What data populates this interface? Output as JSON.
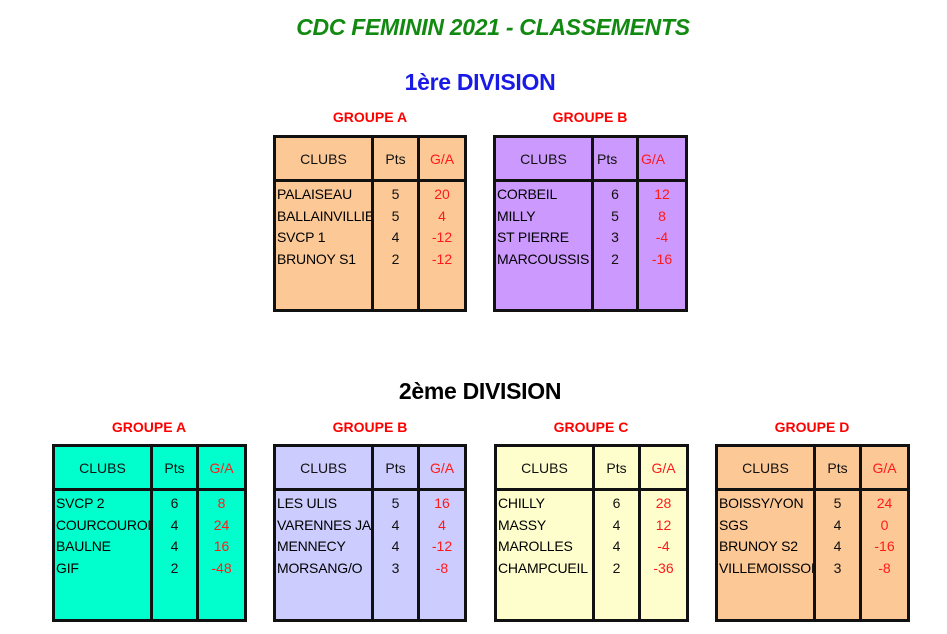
{
  "title": "CDC FEMININ 2021 - CLASSEMENTS",
  "headers": {
    "clubs": "CLUBS",
    "pts": "Pts",
    "ga": "G/A"
  },
  "colors": {
    "title": "#128a12",
    "division1": "#1a1ae6",
    "group_label": "#ff0000",
    "ga_value": "#ff1a1a"
  },
  "divisions": [
    {
      "name": "1ère DIVISION",
      "groups": [
        {
          "label": "GROUPE A",
          "color": "#fcc996",
          "rows": [
            {
              "club": "PALAISEAU",
              "pts": "5",
              "ga": "20"
            },
            {
              "club": "BALLAINVILLIE",
              "pts": "5",
              "ga": "4"
            },
            {
              "club": "SVCP 1",
              "pts": "4",
              "ga": "-12"
            },
            {
              "club": "BRUNOY S1",
              "pts": "2",
              "ga": "-12"
            }
          ]
        },
        {
          "label": "GROUPE B",
          "color": "#cc99fe",
          "rows": [
            {
              "club": "CORBEIL",
              "pts": "6",
              "ga": "12"
            },
            {
              "club": "MILLY",
              "pts": "5",
              "ga": "8"
            },
            {
              "club": "ST PIERRE",
              "pts": "3",
              "ga": "-4"
            },
            {
              "club": "MARCOUSSIS",
              "pts": "2",
              "ga": "-16"
            }
          ]
        }
      ]
    },
    {
      "name": "2ème DIVISION",
      "groups": [
        {
          "label": "GROUPE A",
          "color": "#00ffcc",
          "rows": [
            {
              "club": "SVCP 2",
              "pts": "6",
              "ga": "8"
            },
            {
              "club": "COURCOURONNES",
              "pts": "4",
              "ga": "24"
            },
            {
              "club": "BAULNE",
              "pts": "4",
              "ga": "16"
            },
            {
              "club": "GIF",
              "pts": "2",
              "ga": "-48"
            }
          ]
        },
        {
          "label": "GROUPE B",
          "color": "#ccccfe",
          "rows": [
            {
              "club": "LES ULIS",
              "pts": "5",
              "ga": "16"
            },
            {
              "club": "VARENNES JARCY",
              "pts": "4",
              "ga": "4"
            },
            {
              "club": "MENNECY",
              "pts": "4",
              "ga": "-12"
            },
            {
              "club": "MORSANG/O",
              "pts": "3",
              "ga": "-8"
            }
          ]
        },
        {
          "label": "GROUPE C",
          "color": "#fefecc",
          "rows": [
            {
              "club": "CHILLY",
              "pts": "6",
              "ga": "28"
            },
            {
              "club": "MASSY",
              "pts": "4",
              "ga": "12"
            },
            {
              "club": "MAROLLES",
              "pts": "4",
              "ga": "-4"
            },
            {
              "club": "CHAMPCUEIL",
              "pts": "2",
              "ga": "-36"
            }
          ]
        },
        {
          "label": "GROUPE D",
          "color": "#fcc996",
          "rows": [
            {
              "club": "BOISSY/YON",
              "pts": "5",
              "ga": "24"
            },
            {
              "club": "SGS",
              "pts": "4",
              "ga": "0"
            },
            {
              "club": "BRUNOY S2",
              "pts": "4",
              "ga": "-16"
            },
            {
              "club": "VILLEMOISSON",
              "pts": "3",
              "ga": "-8"
            }
          ]
        }
      ]
    }
  ]
}
